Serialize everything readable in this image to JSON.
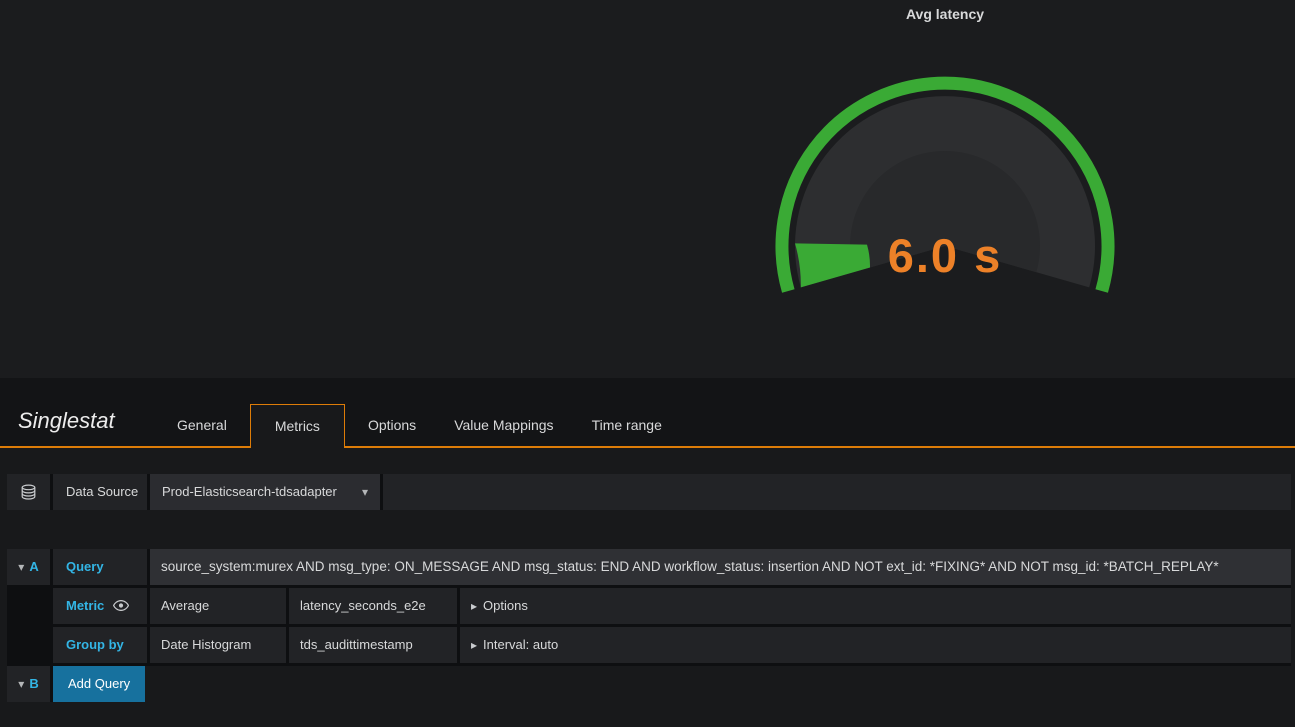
{
  "panel": {
    "title": "Avg latency",
    "value": "6.0 s",
    "value_color": "#ed8128",
    "gauge_color": "#3aaa35",
    "gauge_bg_color": "#2d2e30"
  },
  "editor": {
    "panel_type": "Singlestat",
    "active_tab": "Metrics",
    "accent_color": "#dd7c08",
    "link_color": "#33b5e5",
    "tabs": [
      {
        "label": "General"
      },
      {
        "label": "Metrics"
      },
      {
        "label": "Options"
      },
      {
        "label": "Value Mappings"
      },
      {
        "label": "Time range"
      }
    ],
    "datasource": {
      "label": "Data Source",
      "value": "Prod-Elasticsearch-tdsadapter"
    },
    "query_a": {
      "letter": "A",
      "query_label": "Query",
      "query": "source_system:murex AND msg_type: ON_MESSAGE AND msg_status: END AND workflow_status: insertion AND NOT ext_id: *FIXING* AND NOT msg_id: *BATCH_REPLAY*",
      "metric_label": "Metric",
      "metric_agg": "Average",
      "metric_field": "latency_seconds_e2e",
      "metric_options": "Options",
      "groupby_label": "Group by",
      "groupby_agg": "Date Histogram",
      "groupby_field": "tds_audittimestamp",
      "groupby_options": "Interval: auto"
    },
    "query_b": {
      "letter": "B",
      "add_button": "Add Query"
    }
  }
}
